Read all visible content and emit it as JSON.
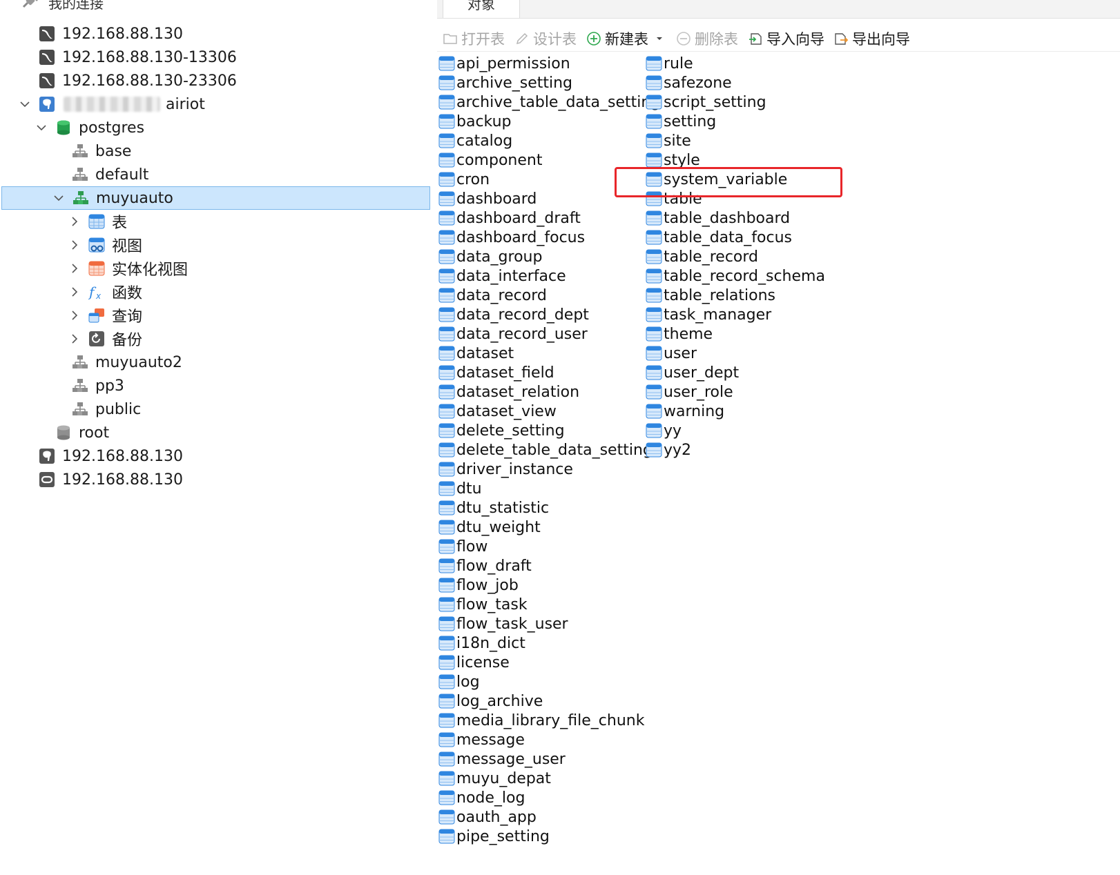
{
  "navigator": {
    "header": "我的连接",
    "rows": [
      {
        "label": "192.168.88.130",
        "icon": "mysql-connection-icon"
      },
      {
        "label": "192.168.88.130-13306",
        "icon": "mysql-connection-icon"
      },
      {
        "label": "192.168.88.130-23306",
        "icon": "mysql-connection-icon"
      },
      {
        "label": "airiot",
        "icon": "postgresql-connection-icon"
      },
      {
        "label": "postgres",
        "icon": "database-icon"
      },
      {
        "label": "base",
        "icon": "schema-icon"
      },
      {
        "label": "default",
        "icon": "schema-icon"
      },
      {
        "label": "muyuauto",
        "icon": "schema-icon"
      },
      {
        "label": "表",
        "icon": "tables-folder-icon"
      },
      {
        "label": "视图",
        "icon": "views-folder-icon"
      },
      {
        "label": "实体化视图",
        "icon": "materialized-views-icon"
      },
      {
        "label": "函数",
        "icon": "functions-icon"
      },
      {
        "label": "查询",
        "icon": "queries-icon"
      },
      {
        "label": "备份",
        "icon": "backup-icon"
      },
      {
        "label": "muyuauto2",
        "icon": "schema-icon"
      },
      {
        "label": "pp3",
        "icon": "schema-icon"
      },
      {
        "label": "public",
        "icon": "schema-icon"
      },
      {
        "label": "root",
        "icon": "database-gray-icon"
      },
      {
        "label": "192.168.88.130",
        "icon": "postgresql-connection-icon"
      },
      {
        "label": "192.168.88.130",
        "icon": "oracle-connection-icon"
      }
    ]
  },
  "panel": {
    "tab_label": "对象",
    "toolbar": {
      "open": "打开表",
      "design": "设计表",
      "new": "新建表",
      "delete": "删除表",
      "import": "导入向导",
      "export": "导出向导"
    },
    "tables_col1": [
      "api_permission",
      "archive_setting",
      "archive_table_data_setting",
      "backup",
      "catalog",
      "component",
      "cron",
      "dashboard",
      "dashboard_draft",
      "dashboard_focus",
      "data_group",
      "data_interface",
      "data_record",
      "data_record_dept",
      "data_record_user",
      "dataset",
      "dataset_field",
      "dataset_relation",
      "dataset_view",
      "delete_setting",
      "delete_table_data_setting",
      "driver_instance",
      "dtu",
      "dtu_statistic",
      "dtu_weight",
      "flow",
      "flow_draft",
      "flow_job",
      "flow_task",
      "flow_task_user",
      "i18n_dict",
      "license",
      "log",
      "log_archive",
      "media_library_file_chunk",
      "message",
      "message_user",
      "muyu_depat",
      "node_log",
      "oauth_app",
      "pipe_setting"
    ],
    "tables_col2": [
      "rule",
      "safezone",
      "script_setting",
      "setting",
      "site",
      "style",
      "system_variable",
      "table",
      "table_dashboard",
      "table_data_focus",
      "table_record",
      "table_record_schema",
      "table_relations",
      "task_manager",
      "theme",
      "user",
      "user_dept",
      "user_role",
      "warning",
      "yy",
      "yy2"
    ],
    "highlighted_table": "system_variable",
    "highlight_color": "#e8262a"
  },
  "colors": {
    "selection_bg": "#cce6fd",
    "selection_border": "#7ab6ea",
    "table_icon_blue": "#2f86e0"
  }
}
